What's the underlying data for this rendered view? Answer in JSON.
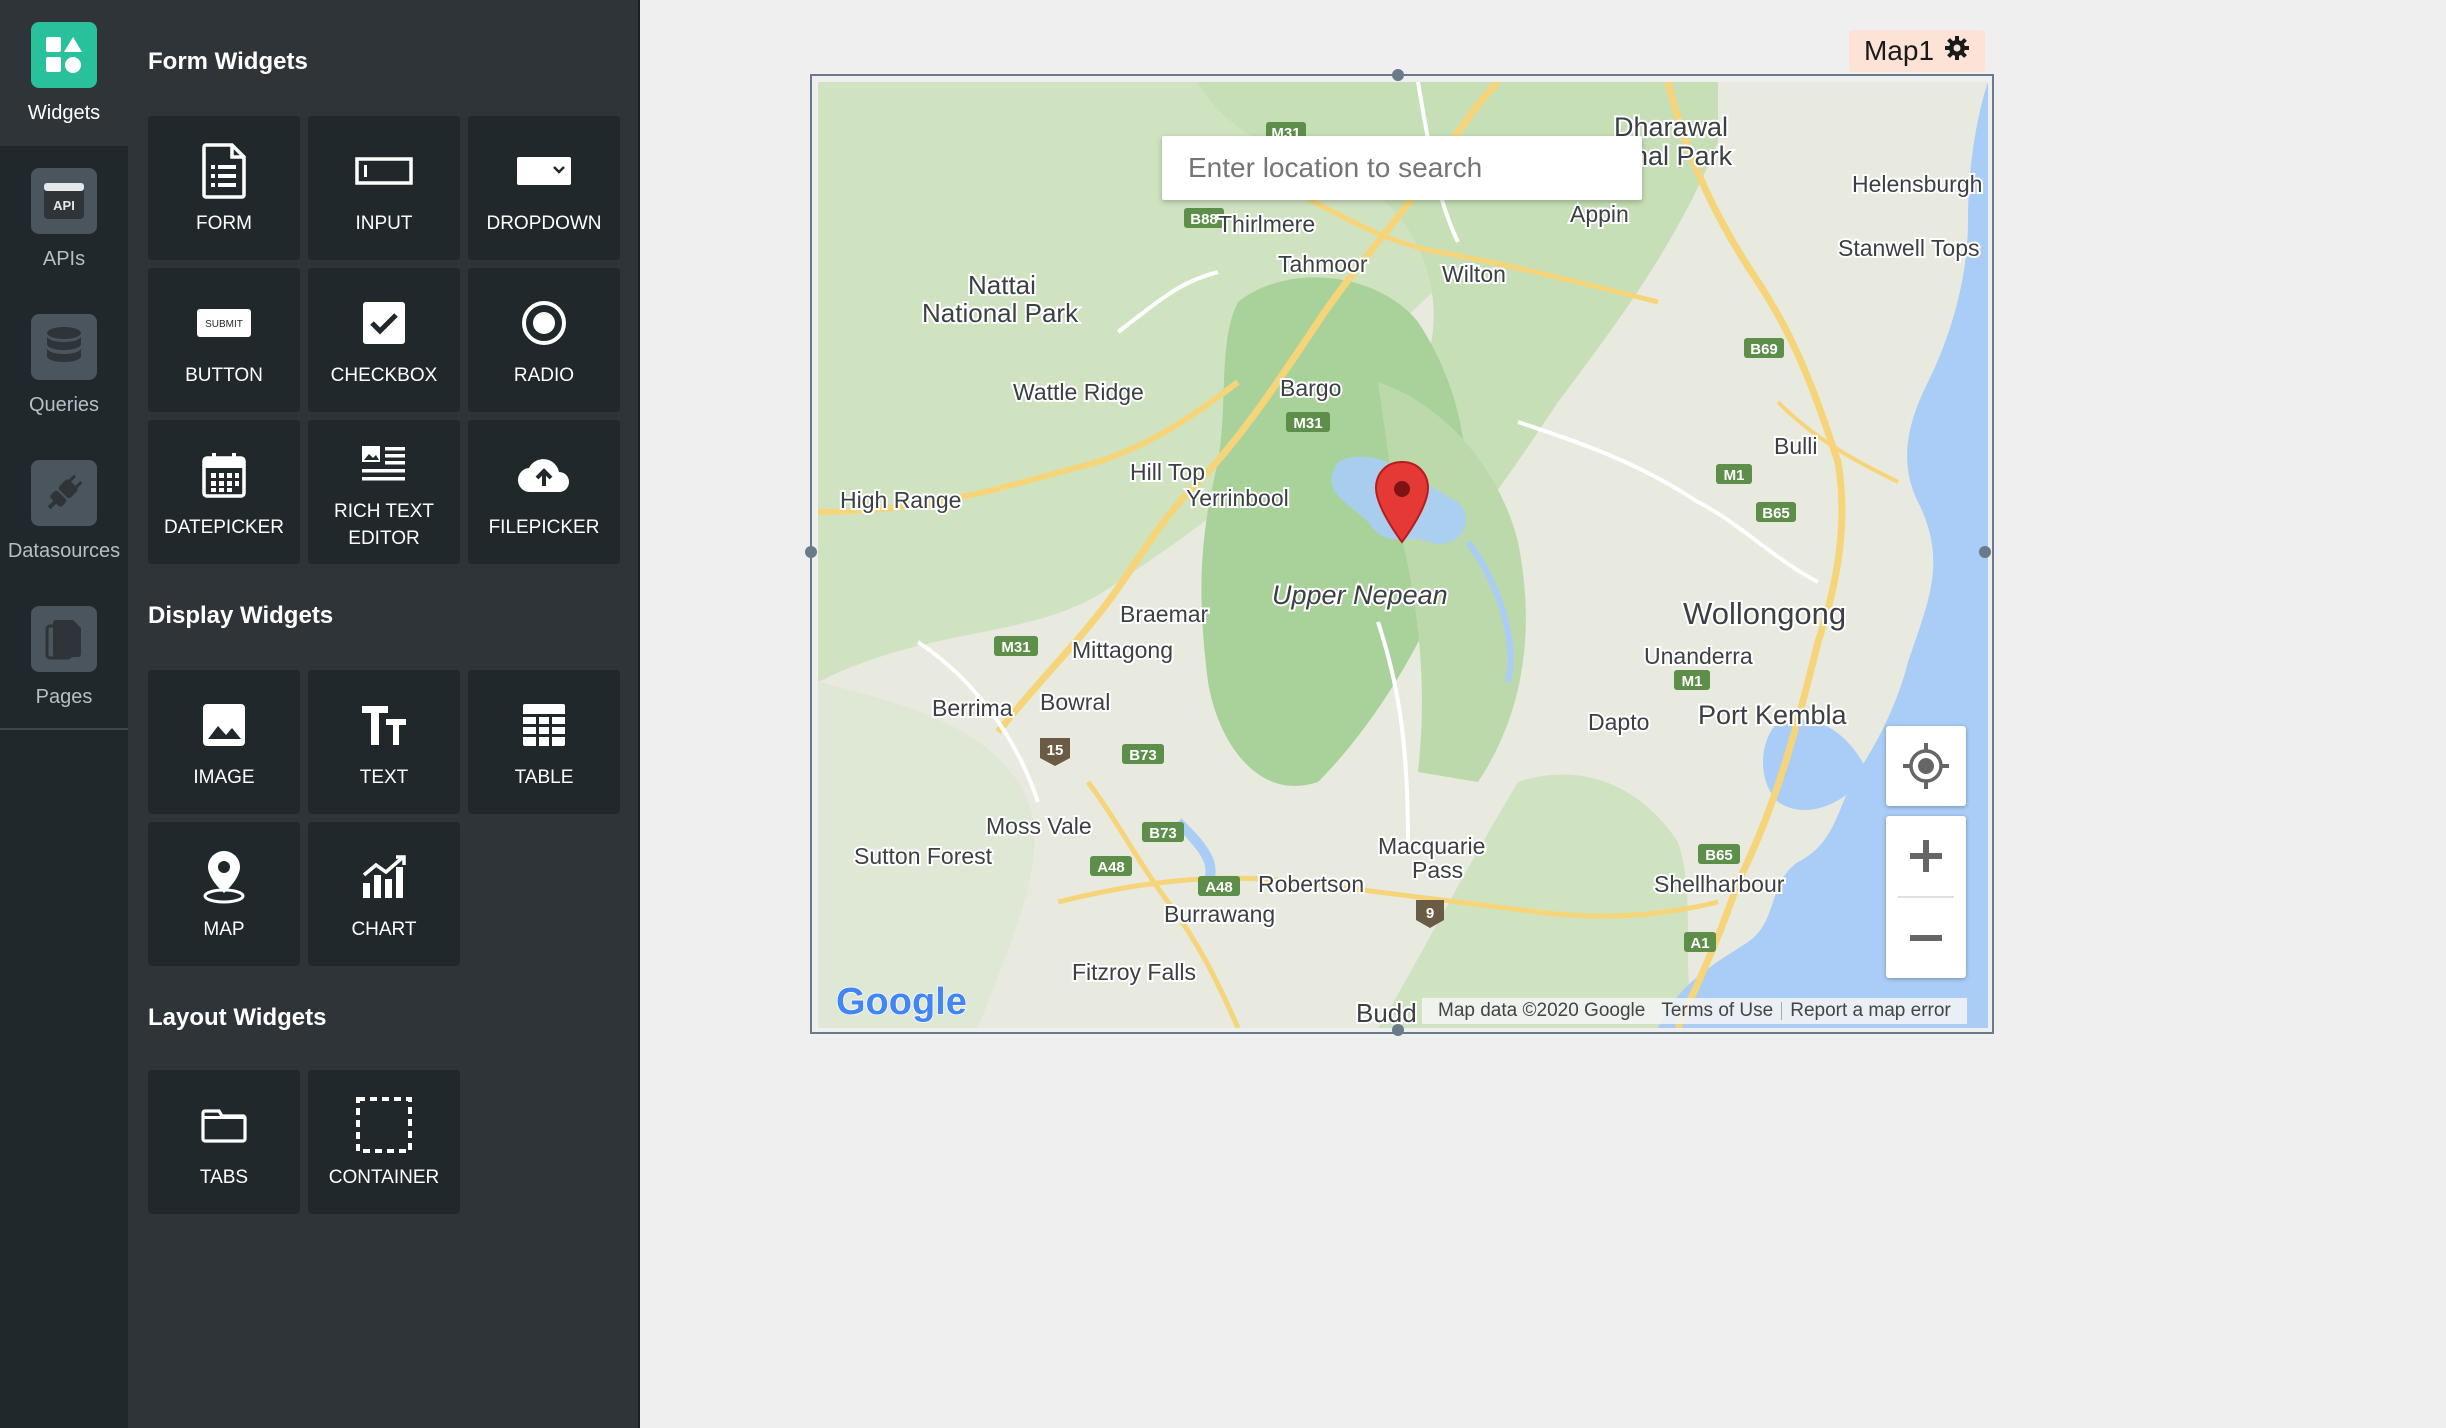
{
  "nav": {
    "items": [
      {
        "label": "Widgets",
        "icon": "widgets-icon",
        "active": true
      },
      {
        "label": "APIs",
        "icon": "api-icon",
        "active": false
      },
      {
        "label": "Queries",
        "icon": "database-icon",
        "active": false
      },
      {
        "label": "Datasources",
        "icon": "plug-icon",
        "active": false
      },
      {
        "label": "Pages",
        "icon": "pages-icon",
        "active": false
      }
    ]
  },
  "explorer": {
    "form_title": "Form Widgets",
    "form_widgets": [
      {
        "label": "FORM",
        "icon": "form-icon"
      },
      {
        "label": "INPUT",
        "icon": "input-icon"
      },
      {
        "label": "DROPDOWN",
        "icon": "dropdown-icon"
      },
      {
        "label": "BUTTON",
        "icon": "button-icon",
        "badge": "SUBMIT"
      },
      {
        "label": "CHECKBOX",
        "icon": "checkbox-icon"
      },
      {
        "label": "RADIO",
        "icon": "radio-icon"
      },
      {
        "label": "DATEPICKER",
        "icon": "calendar-icon"
      },
      {
        "label": "RICH TEXT EDITOR",
        "icon": "rich-text-icon"
      },
      {
        "label": "FILEPICKER",
        "icon": "cloud-upload-icon"
      }
    ],
    "display_title": "Display Widgets",
    "display_widgets": [
      {
        "label": "IMAGE",
        "icon": "image-icon"
      },
      {
        "label": "TEXT",
        "icon": "text-icon"
      },
      {
        "label": "TABLE",
        "icon": "table-icon"
      },
      {
        "label": "MAP",
        "icon": "map-pin-icon"
      },
      {
        "label": "CHART",
        "icon": "chart-icon"
      }
    ],
    "layout_title": "Layout Widgets",
    "layout_widgets": [
      {
        "label": "TABS",
        "icon": "tabs-icon"
      },
      {
        "label": "CONTAINER",
        "icon": "container-icon"
      }
    ]
  },
  "map_widget": {
    "name": "Map1",
    "search_placeholder": "Enter location to search",
    "attribution": {
      "data": "Map data ©2020 Google",
      "terms": "Terms of Use",
      "report": "Report a map error"
    },
    "logo": "Google",
    "places": [
      {
        "name": "Dharawal",
        "size": 27
      },
      {
        "name": "onal Park",
        "size": 27
      },
      {
        "name": "Helensburgh",
        "size": 23
      },
      {
        "name": "Thirlmere",
        "size": 23
      },
      {
        "name": "Appin",
        "size": 23
      },
      {
        "name": "Stanwell Tops",
        "size": 23
      },
      {
        "name": "Tahmoor",
        "size": 23
      },
      {
        "name": "Wilton",
        "size": 23
      },
      {
        "name": "Nattai",
        "size": 26
      },
      {
        "name": "National Park",
        "size": 26
      },
      {
        "name": "Bargo",
        "size": 23
      },
      {
        "name": "Wattle Ridge",
        "size": 23
      },
      {
        "name": "Bulli",
        "size": 23
      },
      {
        "name": "Hill Top",
        "size": 23
      },
      {
        "name": "Yerrinbool",
        "size": 23
      },
      {
        "name": "High Range",
        "size": 23
      },
      {
        "name": "Upper Nepean",
        "size": 27
      },
      {
        "name": "Wollongong",
        "size": 31
      },
      {
        "name": "Braemar",
        "size": 23
      },
      {
        "name": "Mittagong",
        "size": 23
      },
      {
        "name": "Unanderra",
        "size": 23
      },
      {
        "name": "Bowral",
        "size": 23
      },
      {
        "name": "Berrima",
        "size": 23
      },
      {
        "name": "Dapto",
        "size": 23
      },
      {
        "name": "Port Kembla",
        "size": 27
      },
      {
        "name": "Moss Vale",
        "size": 23
      },
      {
        "name": "Sutton Forest",
        "size": 23
      },
      {
        "name": "Macquarie",
        "size": 23
      },
      {
        "name": "Pass",
        "size": 23
      },
      {
        "name": "Robertson",
        "size": 23
      },
      {
        "name": "Shellharbour",
        "size": 23
      },
      {
        "name": "Burrawang",
        "size": 23
      },
      {
        "name": "Fitzroy Falls",
        "size": 23
      },
      {
        "name": "Budd",
        "size": 26
      }
    ],
    "road_badges": [
      "M31",
      "B88",
      "B69",
      "M31",
      "M1",
      "B65",
      "M31",
      "M1",
      "15",
      "B73",
      "B73",
      "A48",
      "A48",
      "B65",
      "9",
      "A1"
    ]
  }
}
